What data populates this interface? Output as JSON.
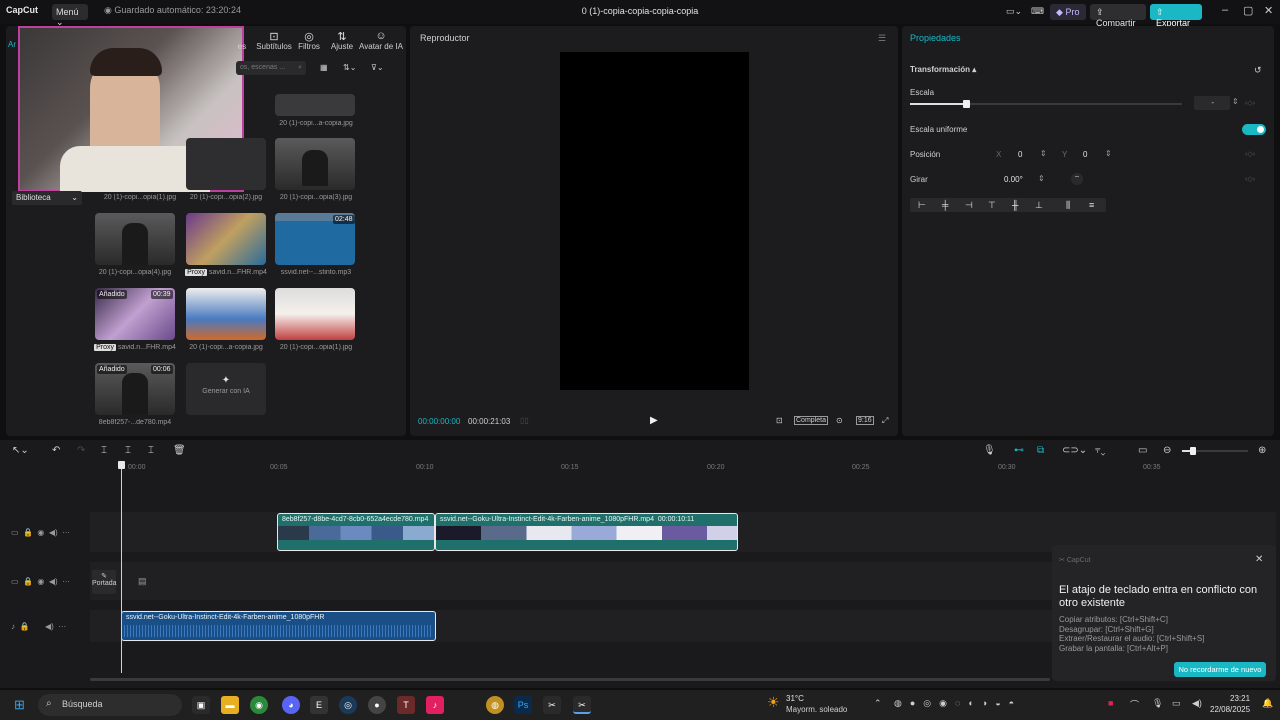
{
  "app": {
    "name": "CapCut",
    "menu_label": "Menú",
    "autosave": "Guardado automático: 23:20:24",
    "project_title": "0 (1)-copia-copia-copia-copia"
  },
  "topbar": {
    "pro": "Pro",
    "share": "Compartir",
    "export": "Exportar"
  },
  "media_toolbar": [
    {
      "label": "es",
      "icon": "..."
    },
    {
      "label": "Subtítulos",
      "icon": "T"
    },
    {
      "label": "Filtros",
      "icon": "◎"
    },
    {
      "label": "Ajuste",
      "icon": "⇅"
    },
    {
      "label": "Avatar de IA",
      "icon": "☺"
    }
  ],
  "media": {
    "search_placeholder": "os, escenas ...",
    "library_label": "Biblioteca",
    "left_tab": "Ar",
    "items": [
      {
        "label": "20 (1)-copi...a-copia.jpg",
        "badge": "",
        "proxy": false
      },
      {
        "label": "20 (1)-copi...opia(1).jpg",
        "badge": "",
        "proxy": false
      },
      {
        "label": "20 (1)-copi...opia(2).jpg",
        "badge": "",
        "proxy": false
      },
      {
        "label": "20 (1)-copi...opia(3).jpg",
        "badge": "",
        "proxy": false
      },
      {
        "label": "20 (1)-copi...opia(4).jpg",
        "badge": "",
        "proxy": false
      },
      {
        "label": "savid.n...FHR.mp4",
        "badge": "",
        "proxy": true
      },
      {
        "label": "ssvid.net--...stinto.mp3",
        "badge": "02:48",
        "proxy": false
      },
      {
        "label": "savid.n...FHR.mp4",
        "badge": "00:39",
        "added": "Añadido",
        "proxy": true
      },
      {
        "label": "20 (1)-copi...a-copia.jpg",
        "badge": "",
        "proxy": false
      },
      {
        "label": "20 (1)-copi...opia(1).jpg",
        "badge": "",
        "proxy": false
      },
      {
        "label": "8eb8f257-...de780.mp4",
        "badge": "00:06",
        "added": "Añadido",
        "proxy": false
      }
    ],
    "generate_ai": "Generar con IA",
    "proxy_label": "Proxy"
  },
  "player": {
    "title": "Reproductor",
    "current_time": "00:00:00:00",
    "total_time": "00:00:21:03",
    "full_label": "Completa",
    "ratio_label": "9:16"
  },
  "props": {
    "tab": "Propiedades",
    "section": "Transformación",
    "scale_label": "Escala",
    "scale_value": "-",
    "uniform_label": "Escala uniforme",
    "position_label": "Posición",
    "pos_x_label": "X",
    "pos_x": "0",
    "pos_y_label": "Y",
    "pos_y": "0",
    "rotate_label": "Girar",
    "rotate_value": "0.00°",
    "rotate_dash": "–"
  },
  "timeline": {
    "ruler": [
      "00:00",
      "00:05",
      "00:10",
      "00:15",
      "00:20",
      "00:25",
      "00:30",
      "00:35"
    ],
    "cover_label": "Portada",
    "clips": {
      "video1": "8eb8f257-d8be-4cd7-8cb0-652a4ecde780.mp4",
      "video2": "ssvid.net--Goku-Ultra-Instinct-Edit-4k-Farben-anime_1080pFHR.mp4",
      "video2_duration": "00:00:10:11",
      "audio": "ssvid.net--Goku-Ultra-Instinct-Edit-4k-Farben-anime_1080pFHR"
    }
  },
  "notice": {
    "app": "CapCut",
    "title": "El atajo de teclado entra en conflicto con otro existente",
    "lines": [
      "Copiar atributos: [Ctrl+Shift+C]",
      "Desagrupar: [Ctrl+Shift+G]",
      "Extraer/Restaurar el audio: [Ctrl+Shift+S]",
      "Grabar la pantalla: [Ctrl+Alt+P]"
    ],
    "button": "No recordarme de nuevo"
  },
  "taskbar": {
    "search": "Búsqueda",
    "weather_temp": "31°C",
    "weather_desc": "Mayorm. soleado",
    "time": "23:21",
    "date": "22/08/2025"
  },
  "colors": {
    "accent": "#1ab8c4",
    "video_clip": "#1f6f6a",
    "audio_clip": "#1a4e86"
  }
}
